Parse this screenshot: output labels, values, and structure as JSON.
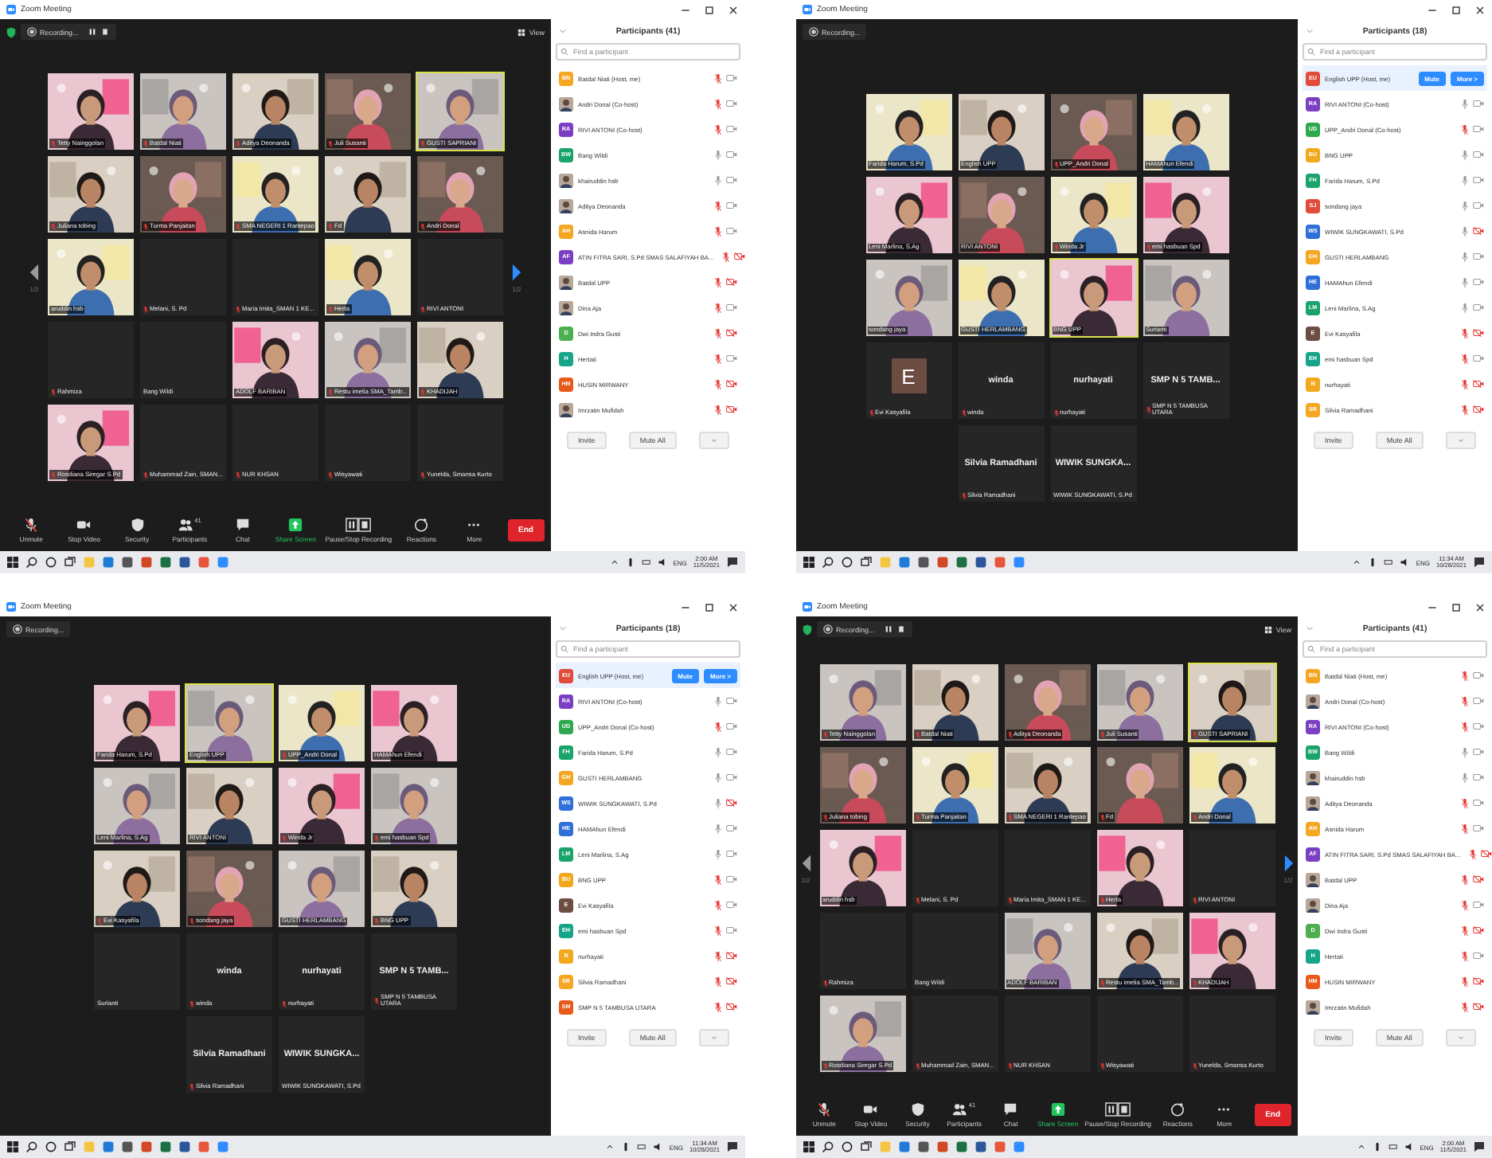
{
  "screens": [
    {
      "window": {
        "title": "Zoom Meeting"
      },
      "top_bar": {
        "security": true,
        "recording": "Recording...",
        "recording_controls": true,
        "view_button": "View"
      },
      "gallery": {
        "prev_page": "1/2",
        "next_page": "1/2",
        "tiles": [
          {
            "kind": "video",
            "name": "Tetty Nainggolan",
            "muted": true,
            "active": false
          },
          {
            "kind": "video",
            "name": "Batdal Niati",
            "muted": true,
            "active": false
          },
          {
            "kind": "video",
            "name": "Aditya Deonanda",
            "muted": true,
            "active": false
          },
          {
            "kind": "video",
            "name": "Juli Susanti",
            "muted": true,
            "active": false
          },
          {
            "kind": "video",
            "name": "GUSTI SAPRIANI",
            "muted": true,
            "active": true
          },
          {
            "kind": "video",
            "name": "Juliana tobing",
            "muted": true,
            "active": false
          },
          {
            "kind": "video",
            "name": "Turma Panjaitan",
            "muted": true,
            "active": false
          },
          {
            "kind": "video",
            "name": "SMA NEGERI 1 Rantepao",
            "muted": true,
            "active": false
          },
          {
            "kind": "video",
            "name": "Fd",
            "muted": true,
            "active": false
          },
          {
            "kind": "video",
            "name": "Andri Donal",
            "muted": true,
            "active": false
          },
          {
            "kind": "video",
            "name": "aruddin hsb",
            "muted": false,
            "active": false
          },
          {
            "kind": "blank",
            "name": "Melani, S. Pd",
            "muted": true,
            "active": false
          },
          {
            "kind": "blank",
            "name": "Maria Imita_SMAN 1 KE...",
            "muted": true,
            "active": false
          },
          {
            "kind": "video",
            "name": "Herta",
            "muted": true,
            "active": false
          },
          {
            "kind": "blank",
            "name": "RIVI ANTONI",
            "muted": true,
            "active": false
          },
          {
            "kind": "blank",
            "name": "Rahmiza",
            "muted": true,
            "active": false
          },
          {
            "kind": "blank",
            "name": "Bang Wildi",
            "muted": false,
            "active": false
          },
          {
            "kind": "video",
            "name": "ADOLF BARIBAN",
            "muted": false,
            "active": false
          },
          {
            "kind": "video",
            "name": "Restu imelia SMA_Tamb...",
            "muted": true,
            "active": false
          },
          {
            "kind": "video",
            "name": "KHADIJAH",
            "muted": true,
            "active": false
          },
          {
            "kind": "video",
            "name": "Rosdiana Siregar S.Pd",
            "muted": true,
            "active": false
          },
          {
            "kind": "blank",
            "name": "Muhammad Zain, SMAN...",
            "muted": true,
            "active": false
          },
          {
            "kind": "blank",
            "name": "NUR KHSAN",
            "muted": true,
            "active": false
          },
          {
            "kind": "blank",
            "name": "Wisyawati",
            "muted": true,
            "active": false
          },
          {
            "kind": "blank",
            "name": "Yunelda, Smansa Kurto",
            "muted": true,
            "active": false
          }
        ]
      },
      "toolbar": {
        "buttons": [
          {
            "kind": "unmute",
            "label": "Unmute"
          },
          {
            "kind": "video",
            "label": "Stop Video"
          },
          {
            "kind": "security",
            "label": "Security"
          },
          {
            "kind": "participants",
            "label": "Participants",
            "count": "41"
          },
          {
            "kind": "chat",
            "label": "Chat"
          },
          {
            "kind": "share",
            "label": "Share Screen"
          },
          {
            "kind": "recording",
            "label": "Pause/Stop Recording"
          },
          {
            "kind": "reactions",
            "label": "Reactions"
          },
          {
            "kind": "more",
            "label": "More"
          }
        ],
        "end": "End"
      },
      "participants": {
        "title": "Participants (41)",
        "search_placeholder": "Find a participant",
        "items": [
          {
            "name": "Batdal Niati (Host, me)",
            "avatar": {
              "kind": "initials",
              "text": "BN",
              "color": "#f5a623"
            },
            "muted": true,
            "video_off": false
          },
          {
            "name": "Andri Donal (Co-host)",
            "muted": true,
            "video_off": false
          },
          {
            "name": "RIVI ANTONI (Co-host)",
            "avatar": {
              "kind": "initials",
              "text": "RA",
              "color": "#7b3fc4"
            },
            "muted": true,
            "video_off": false
          },
          {
            "name": "Bang Wildi",
            "avatar": {
              "kind": "initials",
              "text": "BW",
              "color": "#1aa36b"
            },
            "muted": false,
            "video_off": false
          },
          {
            "name": "khairuddin hsb",
            "muted": false,
            "video_off": false
          },
          {
            "name": "Aditya Deonanda",
            "muted": true,
            "video_off": false
          },
          {
            "name": "Asnida Harum",
            "avatar": {
              "kind": "initials",
              "text": "AH",
              "color": "#f5a623"
            },
            "muted": true,
            "video_off": false
          },
          {
            "name": "ATIN FITRA SARI, S.Pd SMAS SALAFIYAH BA...",
            "avatar": {
              "kind": "initials",
              "text": "AF",
              "color": "#7b3fc4"
            },
            "muted": true,
            "video_off": true
          },
          {
            "name": "Batdal UPP",
            "muted": true,
            "video_off": true
          },
          {
            "name": "Dina Aja",
            "muted": true,
            "video_off": false
          },
          {
            "name": "Dwi Indra Gusti",
            "avatar": {
              "kind": "initials",
              "text": "D",
              "color": "#4caf50"
            },
            "muted": true,
            "video_off": true
          },
          {
            "name": "Hertati",
            "avatar": {
              "kind": "initials",
              "text": "H",
              "color": "#17a589"
            },
            "muted": true,
            "video_off": false
          },
          {
            "name": "HUSIN MIRWANY",
            "avatar": {
              "kind": "initials",
              "text": "HM",
              "color": "#e8591a"
            },
            "muted": true,
            "video_off": true
          },
          {
            "name": "Imrzatin Mufidah",
            "muted": true,
            "video_off": true
          }
        ],
        "footer": [
          "Invite",
          "Mute All"
        ]
      },
      "taskbar": {
        "language": "ENG",
        "time": "2:00 AM",
        "date": "11/5/2021"
      }
    },
    {
      "window": {
        "title": "Zoom Meeting"
      },
      "top_bar": {
        "recording": "Recording..."
      },
      "gallery": {
        "tiles": [
          {
            "kind": "video",
            "name": "Farida Harum, S.Pd",
            "muted": false,
            "active": false
          },
          {
            "kind": "video",
            "name": "English UPP",
            "muted": false,
            "active": false
          },
          {
            "kind": "video",
            "name": "UPP_Andri Donal",
            "muted": true,
            "active": false
          },
          {
            "kind": "video",
            "name": "HAMAhun Efendi",
            "muted": false,
            "active": false
          },
          {
            "kind": "video",
            "name": "Leni Marlina, S.Ag",
            "muted": false,
            "active": false
          },
          {
            "kind": "video",
            "name": "RIVI ANTONI",
            "muted": false,
            "active": false
          },
          {
            "kind": "video",
            "name": "Winda Jr",
            "muted": true,
            "active": false
          },
          {
            "kind": "video",
            "name": "emi hasbuan Spd",
            "muted": true,
            "active": false
          },
          {
            "kind": "video",
            "name": "sondang jaya",
            "muted": false,
            "active": false
          },
          {
            "kind": "video",
            "name": "GUSTI HERLAMBANG",
            "muted": false,
            "active": false
          },
          {
            "kind": "video",
            "name": "BNG UPP",
            "muted": false,
            "active": true
          },
          {
            "kind": "video",
            "name": "Surianti",
            "muted": false,
            "active": false
          },
          {
            "kind": "avatar",
            "initial": "E",
            "name": "Evi Kasyafila",
            "muted": true,
            "active": false
          },
          {
            "kind": "name",
            "display_name": "winda",
            "name": "winda",
            "muted": true,
            "active": false
          },
          {
            "kind": "name",
            "display_name": "nurhayati",
            "name": "nurhayati",
            "muted": true,
            "active": false
          },
          {
            "kind": "name",
            "display_name": "SMP N 5 TAMB...",
            "name": "SMP N 5 TAMBUSA UTARA",
            "muted": true,
            "active": false
          },
          {
            "kind": "name",
            "display_name": "Silvia Ramadhani",
            "name": "Silvia Ramadhani",
            "muted": true,
            "active": false
          },
          {
            "kind": "name",
            "display_name": "WIWIK SUNGKA...",
            "name": "WIWIK SUNGKAWATI, S.Pd",
            "muted": false,
            "active": false
          }
        ]
      },
      "participants": {
        "title": "Participants (18)",
        "search_placeholder": "Find a participant",
        "items": [
          {
            "name": "English UPP (Host, me)",
            "avatar": {
              "kind": "initials",
              "text": "EU",
              "color": "#e04b3a"
            },
            "buttons": [
              "Mute",
              "More >"
            ]
          },
          {
            "name": "RIVI ANTONI (Co-host)",
            "avatar": {
              "kind": "initials",
              "text": "RA",
              "color": "#7b3fc4"
            },
            "muted": false,
            "video_off": false
          },
          {
            "name": "UPP_Andri Donal (Co-host)",
            "avatar": {
              "kind": "initials",
              "text": "UD",
              "color": "#2ea84f"
            },
            "muted": true,
            "video_off": false
          },
          {
            "name": "BNG UPP",
            "avatar": {
              "kind": "initials",
              "text": "BU",
              "color": "#f2a81d"
            },
            "muted": false,
            "video_off": false
          },
          {
            "name": "Farida Harum, S.Pd",
            "avatar": {
              "kind": "initials",
              "text": "FH",
              "color": "#1aa36b"
            },
            "muted": false,
            "video_off": false
          },
          {
            "name": "sondang jaya",
            "avatar": {
              "kind": "initials",
              "text": "SJ",
              "color": "#e04b3a"
            },
            "muted": false,
            "video_off": false
          },
          {
            "name": "WIWIK SUNGKAWATI, S.Pd",
            "avatar": {
              "kind": "initials",
              "text": "WS",
              "color": "#2e6fd8"
            },
            "muted": false,
            "video_off": true
          },
          {
            "name": "GUSTI HERLAMBANG",
            "avatar": {
              "kind": "initials",
              "text": "GH",
              "color": "#f5a623"
            },
            "muted": false,
            "video_off": false
          },
          {
            "name": "HAMAhun Efendi",
            "avatar": {
              "kind": "initials",
              "text": "HE",
              "color": "#2e6fd8"
            },
            "muted": false,
            "video_off": false
          },
          {
            "name": "Leni Marlina, S.Ag",
            "avatar": {
              "kind": "initials",
              "text": "LM",
              "color": "#1aa36b"
            },
            "muted": false,
            "video_off": false
          },
          {
            "name": "Evi Kasyafila",
            "avatar": {
              "kind": "initials",
              "text": "E",
              "color": "#6d4c41"
            },
            "muted": true,
            "video_off": true
          },
          {
            "name": "emi hasbuan Spd",
            "avatar": {
              "kind": "initials",
              "text": "EH",
              "color": "#17a589"
            },
            "muted": true,
            "video_off": false
          },
          {
            "name": "nurhayati",
            "avatar": {
              "kind": "initials",
              "text": "N",
              "color": "#f2a81d"
            },
            "muted": true,
            "video_off": true
          },
          {
            "name": "Silvia Ramadhani",
            "avatar": {
              "kind": "initials",
              "text": "SR",
              "color": "#f5a623"
            },
            "muted": true,
            "video_off": true
          }
        ],
        "footer": [
          "Invite",
          "Mute All"
        ]
      },
      "taskbar": {
        "language": "ENG",
        "time": "11:34 AM",
        "date": "10/28/2021"
      }
    },
    {
      "window": {
        "title": "Zoom Meeting"
      },
      "top_bar": {
        "recording": "Recording..."
      },
      "gallery": {
        "tiles": [
          {
            "kind": "video",
            "name": "Farida Harum, S.Pd",
            "muted": false,
            "active": false
          },
          {
            "kind": "video",
            "name": "English UPP",
            "muted": false,
            "active": true
          },
          {
            "kind": "video",
            "name": "UPP_Andri Donal",
            "muted": true,
            "active": false
          },
          {
            "kind": "video",
            "name": "HAMAhun Efendi",
            "muted": false,
            "active": false
          },
          {
            "kind": "video",
            "name": "Leni Marlina, S.Ag",
            "muted": false,
            "active": false
          },
          {
            "kind": "video",
            "name": "RIVI ANTONI",
            "muted": false,
            "active": false
          },
          {
            "kind": "video",
            "name": "Winda Jr",
            "muted": true,
            "active": false
          },
          {
            "kind": "video",
            "name": "emi hasbuan Spd",
            "muted": true,
            "active": false
          },
          {
            "kind": "video",
            "name": "Evi Kasyafila",
            "muted": true,
            "active": false
          },
          {
            "kind": "video",
            "name": "sondang jaya",
            "muted": true,
            "active": false
          },
          {
            "kind": "video",
            "name": "GUSTI HERLAMBANG",
            "muted": false,
            "active": false
          },
          {
            "kind": "video",
            "name": "BNG UPP",
            "muted": true,
            "active": false
          },
          {
            "kind": "blank",
            "name": "Surianti",
            "muted": false,
            "active": false
          },
          {
            "kind": "name",
            "display_name": "winda",
            "name": "winda",
            "muted": true,
            "active": false
          },
          {
            "kind": "name",
            "display_name": "nurhayati",
            "name": "nurhayati",
            "muted": true,
            "active": false
          },
          {
            "kind": "name",
            "display_name": "SMP N 5 TAMB...",
            "name": "SMP N 5 TAMBUSA UTARA",
            "muted": true,
            "active": false
          },
          {
            "kind": "name",
            "display_name": "Silvia Ramadhani",
            "name": "Silvia Ramadhani",
            "muted": true,
            "active": false
          },
          {
            "kind": "name",
            "display_name": "WIWIK SUNGKA...",
            "name": "WIWIK SUNGKAWATI, S.Pd",
            "muted": false,
            "active": false
          }
        ]
      },
      "participants": {
        "title": "Participants (18)",
        "search_placeholder": "Find a participant",
        "items": [
          {
            "name": "English UPP (Host, me)",
            "avatar": {
              "kind": "initials",
              "text": "EU",
              "color": "#e04b3a"
            },
            "buttons": [
              "Mute",
              "More >"
            ]
          },
          {
            "name": "RIVI ANTONI (Co-host)",
            "avatar": {
              "kind": "initials",
              "text": "RA",
              "color": "#7b3fc4"
            },
            "muted": false,
            "video_off": false
          },
          {
            "name": "UPP_Andri Donal (Co-host)",
            "avatar": {
              "kind": "initials",
              "text": "UD",
              "color": "#2ea84f"
            },
            "muted": true,
            "video_off": false
          },
          {
            "name": "Farida Harum, S.Pd",
            "avatar": {
              "kind": "initials",
              "text": "FH",
              "color": "#1aa36b"
            },
            "muted": false,
            "video_off": false
          },
          {
            "name": "GUSTI HERLAMBANG",
            "avatar": {
              "kind": "initials",
              "text": "GH",
              "color": "#f5a623"
            },
            "muted": false,
            "video_off": false
          },
          {
            "name": "WIWIK SUNGKAWATI, S.Pd",
            "avatar": {
              "kind": "initials",
              "text": "WS",
              "color": "#2e6fd8"
            },
            "muted": false,
            "video_off": true
          },
          {
            "name": "HAMAhun Efendi",
            "avatar": {
              "kind": "initials",
              "text": "HE",
              "color": "#2e6fd8"
            },
            "muted": false,
            "video_off": false
          },
          {
            "name": "Leni Marlina, S.Ag",
            "avatar": {
              "kind": "initials",
              "text": "LM",
              "color": "#1aa36b"
            },
            "muted": false,
            "video_off": false
          },
          {
            "name": "BNG UPP",
            "avatar": {
              "kind": "initials",
              "text": "BU",
              "color": "#f2a81d"
            },
            "muted": true,
            "video_off": false
          },
          {
            "name": "Evi Kasyafila",
            "avatar": {
              "kind": "initials",
              "text": "E",
              "color": "#6d4c41"
            },
            "muted": true,
            "video_off": false
          },
          {
            "name": "emi hasbuan Spd",
            "avatar": {
              "kind": "initials",
              "text": "EH",
              "color": "#17a589"
            },
            "muted": true,
            "video_off": false
          },
          {
            "name": "nurhayati",
            "avatar": {
              "kind": "initials",
              "text": "N",
              "color": "#f2a81d"
            },
            "muted": true,
            "video_off": true
          },
          {
            "name": "Silvia Ramadhani",
            "avatar": {
              "kind": "initials",
              "text": "SR",
              "color": "#f5a623"
            },
            "muted": true,
            "video_off": true
          },
          {
            "name": "SMP N 5 TAMBUSA UTARA",
            "avatar": {
              "kind": "initials",
              "text": "SM",
              "color": "#e8591a"
            },
            "muted": true,
            "video_off": true
          }
        ],
        "footer": [
          "Invite",
          "Mute All"
        ]
      },
      "taskbar": {
        "language": "ENG",
        "time": "11:34 AM",
        "date": "10/28/2021"
      }
    },
    {
      "window": {
        "title": "Zoom Meeting"
      },
      "top_bar": {
        "security": true,
        "recording": "Recording...",
        "recording_controls": true,
        "view_button": "View"
      },
      "gallery": {
        "prev_page": "1/2",
        "next_page": "1/2",
        "tiles": [
          {
            "kind": "video",
            "name": "Tetty Nainggolan",
            "muted": true,
            "active": false
          },
          {
            "kind": "video",
            "name": "Batdal Niati",
            "muted": true,
            "active": false
          },
          {
            "kind": "video",
            "name": "Aditya Deonanda",
            "muted": true,
            "active": false
          },
          {
            "kind": "video",
            "name": "Juli Susanti",
            "muted": true,
            "active": false
          },
          {
            "kind": "video",
            "name": "GUSTI SAPRIANI",
            "muted": true,
            "active": true
          },
          {
            "kind": "video",
            "name": "Juliana tobing",
            "muted": true,
            "active": false
          },
          {
            "kind": "video",
            "name": "Turma Panjaitan",
            "muted": true,
            "active": false
          },
          {
            "kind": "video",
            "name": "SMA NEGERI 1 Rantepao",
            "muted": true,
            "active": false
          },
          {
            "kind": "video",
            "name": "Fd",
            "muted": true,
            "active": false
          },
          {
            "kind": "video",
            "name": "Andri Donal",
            "muted": true,
            "active": false
          },
          {
            "kind": "video",
            "name": "aruddin hsb",
            "muted": false,
            "active": false
          },
          {
            "kind": "blank",
            "name": "Melani, S. Pd",
            "muted": true,
            "active": false
          },
          {
            "kind": "blank",
            "name": "Maria Imita_SMAN 1 KE...",
            "muted": true,
            "active": false
          },
          {
            "kind": "video",
            "name": "Herta",
            "muted": true,
            "active": false
          },
          {
            "kind": "blank",
            "name": "RIVI ANTONI",
            "muted": true,
            "active": false
          },
          {
            "kind": "blank",
            "name": "Rahmiza",
            "muted": true,
            "active": false
          },
          {
            "kind": "blank",
            "name": "Bang Wildi",
            "muted": false,
            "active": false
          },
          {
            "kind": "video",
            "name": "ADOLF BARIBAN",
            "muted": false,
            "active": false
          },
          {
            "kind": "video",
            "name": "Restu imelia SMA_Tamb...",
            "muted": true,
            "active": false
          },
          {
            "kind": "video",
            "name": "KHADIJAH",
            "muted": true,
            "active": false
          },
          {
            "kind": "video",
            "name": "Rosdiana Siregar S.Pd",
            "muted": true,
            "active": false
          },
          {
            "kind": "blank",
            "name": "Muhammad Zain, SMAN...",
            "muted": true,
            "active": false
          },
          {
            "kind": "blank",
            "name": "NUR KHSAN",
            "muted": true,
            "active": false
          },
          {
            "kind": "blank",
            "name": "Wisyawati",
            "muted": true,
            "active": false
          },
          {
            "kind": "blank",
            "name": "Yunelda, Smansa Kurto",
            "muted": true,
            "active": false
          }
        ]
      },
      "toolbar": {
        "buttons": [
          {
            "kind": "unmute",
            "label": "Unmute"
          },
          {
            "kind": "video",
            "label": "Stop Video"
          },
          {
            "kind": "security",
            "label": "Security"
          },
          {
            "kind": "participants",
            "label": "Participants",
            "count": "41"
          },
          {
            "kind": "chat",
            "label": "Chat"
          },
          {
            "kind": "share",
            "label": "Share Screen"
          },
          {
            "kind": "recording",
            "label": "Pause/Stop Recording"
          },
          {
            "kind": "reactions",
            "label": "Reactions"
          },
          {
            "kind": "more",
            "label": "More"
          }
        ],
        "end": "End"
      },
      "participants": {
        "title": "Participants (41)",
        "search_placeholder": "Find a participant",
        "items": [
          {
            "name": "Batdal Niati (Host, me)",
            "avatar": {
              "kind": "initials",
              "text": "BN",
              "color": "#f5a623"
            },
            "muted": true,
            "video_off": false
          },
          {
            "name": "Andri Donal (Co-host)",
            "muted": true,
            "video_off": false
          },
          {
            "name": "RIVI ANTONI (Co-host)",
            "avatar": {
              "kind": "initials",
              "text": "RA",
              "color": "#7b3fc4"
            },
            "muted": true,
            "video_off": false
          },
          {
            "name": "Bang Wildi",
            "avatar": {
              "kind": "initials",
              "text": "BW",
              "color": "#1aa36b"
            },
            "muted": false,
            "video_off": false
          },
          {
            "name": "khairuddin hsb",
            "muted": false,
            "video_off": false
          },
          {
            "name": "Aditya Deonanda",
            "muted": true,
            "video_off": false
          },
          {
            "name": "Asnida Harum",
            "avatar": {
              "kind": "initials",
              "text": "AH",
              "color": "#f5a623"
            },
            "muted": true,
            "video_off": false
          },
          {
            "name": "ATIN FITRA SARI, S.Pd SMAS SALAFIYAH BA...",
            "avatar": {
              "kind": "initials",
              "text": "AF",
              "color": "#7b3fc4"
            },
            "muted": true,
            "video_off": true
          },
          {
            "name": "Batdal UPP",
            "muted": true,
            "video_off": true
          },
          {
            "name": "Dina Aja",
            "muted": true,
            "video_off": false
          },
          {
            "name": "Dwi Indra Gusti",
            "avatar": {
              "kind": "initials",
              "text": "D",
              "color": "#4caf50"
            },
            "muted": true,
            "video_off": true
          },
          {
            "name": "Hertati",
            "avatar": {
              "kind": "initials",
              "text": "H",
              "color": "#17a589"
            },
            "muted": true,
            "video_off": false
          },
          {
            "name": "HUSIN MIRWANY",
            "avatar": {
              "kind": "initials",
              "text": "HM",
              "color": "#e8591a"
            },
            "muted": true,
            "video_off": true
          },
          {
            "name": "Imrzatin Mufidah",
            "muted": true,
            "video_off": true
          }
        ],
        "footer": [
          "Invite",
          "Mute All"
        ]
      },
      "taskbar": {
        "language": "ENG",
        "time": "2:00 AM",
        "date": "11/5/2021"
      }
    }
  ]
}
